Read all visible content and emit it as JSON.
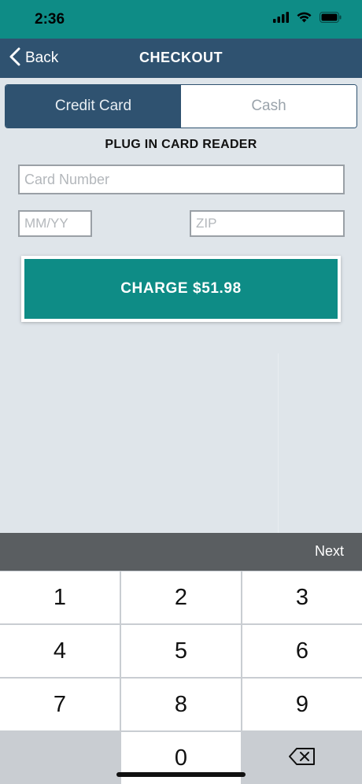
{
  "status": {
    "time": "2:36"
  },
  "nav": {
    "back_label": "Back",
    "title": "CHECKOUT"
  },
  "tabs": [
    {
      "label": "Credit Card",
      "active": true
    },
    {
      "label": "Cash",
      "active": false
    }
  ],
  "instruction": "PLUG IN CARD READER",
  "form": {
    "card_number": {
      "value": "",
      "placeholder": "Card Number"
    },
    "expiry": {
      "value": "",
      "placeholder": "MM/YY"
    },
    "zip": {
      "value": "",
      "placeholder": "ZIP"
    }
  },
  "charge_button": "CHARGE $51.98",
  "accessory": {
    "next_label": "Next"
  },
  "keypad": {
    "keys": [
      "1",
      "2",
      "3",
      "4",
      "5",
      "6",
      "7",
      "8",
      "9",
      "",
      "0",
      "⌫"
    ]
  },
  "colors": {
    "teal": "#0e8c86",
    "navy": "#2f5270",
    "background": "#dfe5ea"
  }
}
